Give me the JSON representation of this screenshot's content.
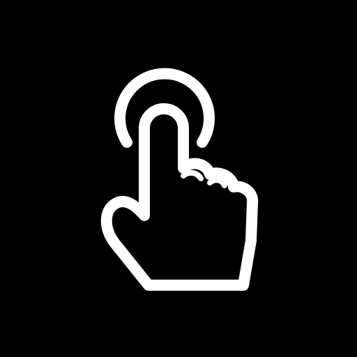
{
  "background_color": "#000000",
  "icon": {
    "name": "tap-gesture-icon",
    "color": "#ffffff"
  }
}
